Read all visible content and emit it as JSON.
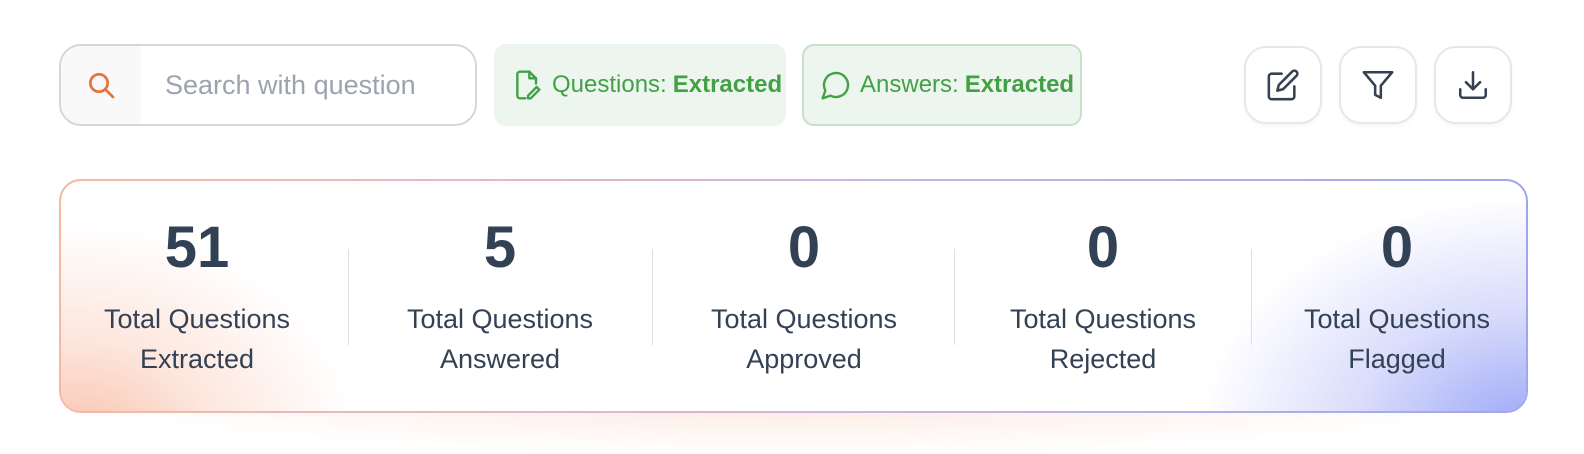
{
  "search": {
    "placeholder": "Search with question"
  },
  "status_pills": {
    "questions": {
      "label": "Questions:",
      "value": "Extracted"
    },
    "answers": {
      "label": "Answers:",
      "value": "Extracted"
    }
  },
  "actions": {
    "edit_icon": "edit-icon",
    "filter_icon": "filter-icon",
    "download_icon": "download-icon"
  },
  "stats": [
    {
      "value": "51",
      "label_line1": "Total Questions",
      "label_line2": "Extracted"
    },
    {
      "value": "5",
      "label_line1": "Total Questions",
      "label_line2": "Answered"
    },
    {
      "value": "0",
      "label_line1": "Total Questions",
      "label_line2": "Approved"
    },
    {
      "value": "0",
      "label_line1": "Total Questions",
      "label_line2": "Rejected"
    },
    {
      "value": "0",
      "label_line1": "Total Questions",
      "label_line2": "Flagged"
    }
  ],
  "colors": {
    "accent_search": "#e8703a",
    "status_green": "#43a047",
    "text_dark": "#334155"
  }
}
